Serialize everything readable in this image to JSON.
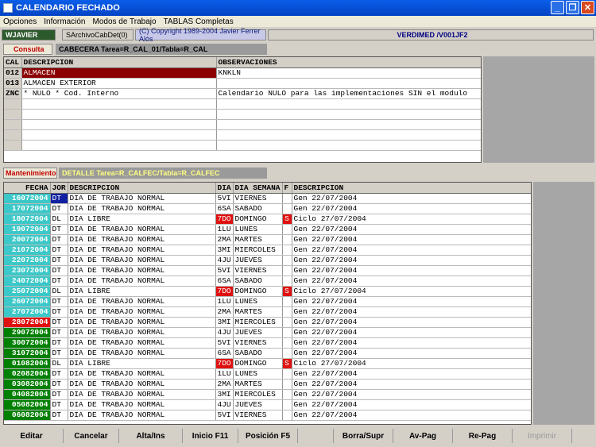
{
  "window": {
    "title": "CALENDARIO FECHADO"
  },
  "menu": [
    "Opciones",
    "Información",
    "Modos de Trabajo",
    "TABLAS Completas"
  ],
  "info": {
    "user": "WJAVIER",
    "archivo": "SArchivoCabDet(0)",
    "copyright": "(C) Copyright 1989-2004 Javier Ferrer Alós",
    "program": "VERDIMED /V001JF2"
  },
  "header": {
    "tab": "Consulta",
    "title": "CABECERA Tarea=R_CAL_01/Tabla=R_CAL",
    "columns": [
      "CAL",
      "DESCRIPCION",
      "OBSERVACIONES"
    ],
    "rows": [
      {
        "cal": "012",
        "desc": "ALMACEN",
        "obs": "KNKLN"
      },
      {
        "cal": "013",
        "desc": "ALMACEN EXTERIOR",
        "obs": ""
      },
      {
        "cal": "ZNC",
        "desc": "* NULO *  Cod. Interno",
        "obs": "Calendario NULO para las implementaciones SIN el modulo"
      }
    ]
  },
  "detail": {
    "tab": "Mantenimiento",
    "title": "DETALLE Tarea=R_CALFEC/Tabla=R_CALFEC",
    "columns": [
      "FECHA",
      "JOR",
      "DESCRIPCION",
      "DIA",
      "DIA SEMANA",
      "F",
      "DESCRIPCION"
    ],
    "rows": [
      {
        "fecha": "16072004",
        "jor": "DT",
        "desc": "DIA DE TRABAJO NORMAL",
        "dia": "5VI",
        "sem": "VIERNES",
        "f": "",
        "desc2": "Gen 22/07/2004",
        "fc": "teal",
        "sel": true
      },
      {
        "fecha": "17072004",
        "jor": "DT",
        "desc": "DIA DE TRABAJO NORMAL",
        "dia": "6SA",
        "sem": "SABADO",
        "f": "",
        "desc2": "Gen 22/07/2004",
        "fc": "teal"
      },
      {
        "fecha": "18072004",
        "jor": "DL",
        "desc": "DIA LIBRE",
        "dia": "7DO",
        "sem": "DOMINGO",
        "f": "S",
        "desc2": "Ciclo 27/07/2004",
        "fc": "teal"
      },
      {
        "fecha": "19072004",
        "jor": "DT",
        "desc": "DIA DE TRABAJO NORMAL",
        "dia": "1LU",
        "sem": "LUNES",
        "f": "",
        "desc2": "Gen 22/07/2004",
        "fc": "teal"
      },
      {
        "fecha": "20072004",
        "jor": "DT",
        "desc": "DIA DE TRABAJO NORMAL",
        "dia": "2MA",
        "sem": "MARTES",
        "f": "",
        "desc2": "Gen 22/07/2004",
        "fc": "teal"
      },
      {
        "fecha": "21072004",
        "jor": "DT",
        "desc": "DIA DE TRABAJO NORMAL",
        "dia": "3MI",
        "sem": "MIERCOLES",
        "f": "",
        "desc2": "Gen 22/07/2004",
        "fc": "teal"
      },
      {
        "fecha": "22072004",
        "jor": "DT",
        "desc": "DIA DE TRABAJO NORMAL",
        "dia": "4JU",
        "sem": "JUEVES",
        "f": "",
        "desc2": "Gen 22/07/2004",
        "fc": "teal"
      },
      {
        "fecha": "23072004",
        "jor": "DT",
        "desc": "DIA DE TRABAJO NORMAL",
        "dia": "5VI",
        "sem": "VIERNES",
        "f": "",
        "desc2": "Gen 22/07/2004",
        "fc": "teal"
      },
      {
        "fecha": "24072004",
        "jor": "DT",
        "desc": "DIA DE TRABAJO NORMAL",
        "dia": "6SA",
        "sem": "SABADO",
        "f": "",
        "desc2": "Gen 22/07/2004",
        "fc": "teal"
      },
      {
        "fecha": "25072004",
        "jor": "DL",
        "desc": "DIA LIBRE",
        "dia": "7DO",
        "sem": "DOMINGO",
        "f": "S",
        "desc2": "Ciclo 27/07/2004",
        "fc": "teal"
      },
      {
        "fecha": "26072004",
        "jor": "DT",
        "desc": "DIA DE TRABAJO NORMAL",
        "dia": "1LU",
        "sem": "LUNES",
        "f": "",
        "desc2": "Gen 22/07/2004",
        "fc": "teal"
      },
      {
        "fecha": "27072004",
        "jor": "DT",
        "desc": "DIA DE TRABAJO NORMAL",
        "dia": "2MA",
        "sem": "MARTES",
        "f": "",
        "desc2": "Gen 22/07/2004",
        "fc": "teal"
      },
      {
        "fecha": "28072004",
        "jor": "DT",
        "desc": "DIA DE TRABAJO NORMAL",
        "dia": "3MI",
        "sem": "MIERCOLES",
        "f": "",
        "desc2": "Gen 22/07/2004",
        "fc": "red"
      },
      {
        "fecha": "29072004",
        "jor": "DT",
        "desc": "DIA DE TRABAJO NORMAL",
        "dia": "4JU",
        "sem": "JUEVES",
        "f": "",
        "desc2": "Gen 22/07/2004",
        "fc": "green"
      },
      {
        "fecha": "30072004",
        "jor": "DT",
        "desc": "DIA DE TRABAJO NORMAL",
        "dia": "5VI",
        "sem": "VIERNES",
        "f": "",
        "desc2": "Gen 22/07/2004",
        "fc": "green"
      },
      {
        "fecha": "31072004",
        "jor": "DT",
        "desc": "DIA DE TRABAJO NORMAL",
        "dia": "6SA",
        "sem": "SABADO",
        "f": "",
        "desc2": "Gen 22/07/2004",
        "fc": "green"
      },
      {
        "fecha": "01082004",
        "jor": "DL",
        "desc": "DIA LIBRE",
        "dia": "7DO",
        "sem": "DOMINGO",
        "f": "S",
        "desc2": "Ciclo 27/07/2004",
        "fc": "green"
      },
      {
        "fecha": "02082004",
        "jor": "DT",
        "desc": "DIA DE TRABAJO NORMAL",
        "dia": "1LU",
        "sem": "LUNES",
        "f": "",
        "desc2": "Gen 22/07/2004",
        "fc": "green"
      },
      {
        "fecha": "03082004",
        "jor": "DT",
        "desc": "DIA DE TRABAJO NORMAL",
        "dia": "2MA",
        "sem": "MARTES",
        "f": "",
        "desc2": "Gen 22/07/2004",
        "fc": "green"
      },
      {
        "fecha": "04082004",
        "jor": "DT",
        "desc": "DIA DE TRABAJO NORMAL",
        "dia": "3MI",
        "sem": "MIERCOLES",
        "f": "",
        "desc2": "Gen 22/07/2004",
        "fc": "green"
      },
      {
        "fecha": "05082004",
        "jor": "DT",
        "desc": "DIA DE TRABAJO NORMAL",
        "dia": "4JU",
        "sem": "JUEVES",
        "f": "",
        "desc2": "Gen 22/07/2004",
        "fc": "green"
      },
      {
        "fecha": "06082004",
        "jor": "DT",
        "desc": "DIA DE TRABAJO NORMAL",
        "dia": "5VI",
        "sem": "VIERNES",
        "f": "",
        "desc2": "Gen 22/07/2004",
        "fc": "green"
      }
    ]
  },
  "buttons": [
    "Editar",
    "Cancelar",
    "Alta/Ins",
    "Inicio F11",
    "Posición F5",
    "",
    "Borra/Supr",
    "Av-Pag",
    "Re-Pag",
    "Imprimir"
  ],
  "colors": {
    "teal": "#3cc8c8",
    "green": "#008000",
    "red": "#e01010",
    "titlebar": "#0a5ee9",
    "sideGray": "#a6a6a6"
  }
}
